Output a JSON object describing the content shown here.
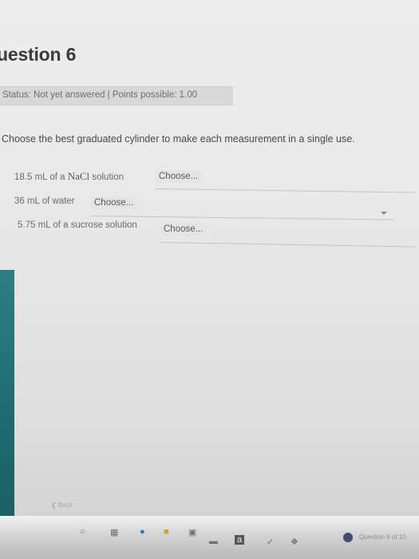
{
  "header": {
    "title": "uestion 6"
  },
  "status": {
    "text": "Status: Not yet answered | Points possible: 1.00"
  },
  "prompt": "Choose the best graduated cylinder to make each measurement in a single use.",
  "rows": [
    {
      "label_pre": "18.5 mL of a ",
      "chem": "NaCl",
      "label_post": " solution",
      "select": "Choose..."
    },
    {
      "label_pre": "36 mL of water",
      "chem": "",
      "label_post": "",
      "select": "Choose..."
    },
    {
      "label_pre": "5.75 mL of a sucrose solution",
      "chem": "",
      "label_post": "",
      "select": "Choose..."
    }
  ],
  "footer": {
    "back_label": "Back",
    "question_counter": "Question 6 of 10"
  },
  "colors": {
    "accent_strip": "#1d6a6e",
    "status_dot": "#3f4c74"
  },
  "icons": [
    "chevron-down-icon",
    "back-chevron-icon",
    "taskbar-icons"
  ]
}
